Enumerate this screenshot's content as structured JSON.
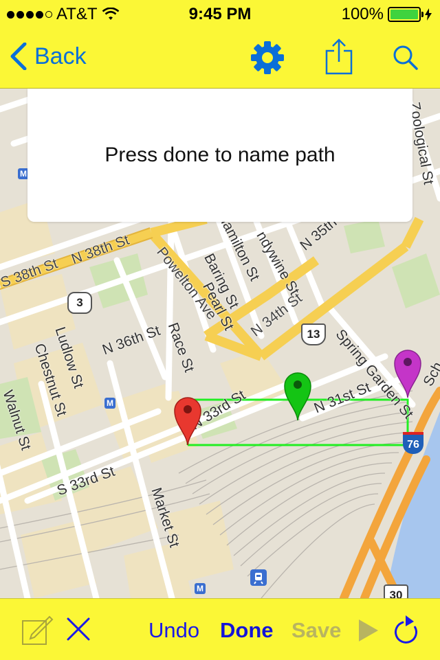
{
  "status_bar": {
    "carrier": "AT&T",
    "time": "9:45 PM",
    "battery_percent": "100%",
    "battery_level": 1.0
  },
  "nav": {
    "back_label": "Back",
    "icons": [
      "settings-gear-icon",
      "share-icon",
      "search-icon"
    ]
  },
  "popup": {
    "message": "Press done to name path"
  },
  "map": {
    "streets": [
      "N 38th St",
      "S 38th St",
      "N 38th St",
      "Powelton Ave",
      "Hamilton St",
      "Baring St",
      "Pearl St",
      "N 34th St",
      "Zoological St",
      "N 35th",
      "ndywine St",
      "N 36th St",
      "Race St",
      "Chestnut St",
      "Ludlow St",
      "Walnut St",
      "N 33rd St",
      "S 33rd St",
      "Market St",
      "N 31st St",
      "Spring Garden St",
      "Sch"
    ],
    "route_shields": [
      "3",
      "13",
      "30"
    ],
    "interstate": "76",
    "metro_label": "M",
    "pins": [
      {
        "name": "start-pin",
        "color": "#e8382f"
      },
      {
        "name": "waypoint-pin",
        "color": "#14c414"
      },
      {
        "name": "end-pin",
        "color": "#c435c8"
      }
    ],
    "path_color": "#22ee22"
  },
  "toolbar": {
    "undo_label": "Undo",
    "done_label": "Done",
    "save_label": "Save",
    "accent_color": "#1a1ae8",
    "disabled_color": "#b8b460"
  }
}
